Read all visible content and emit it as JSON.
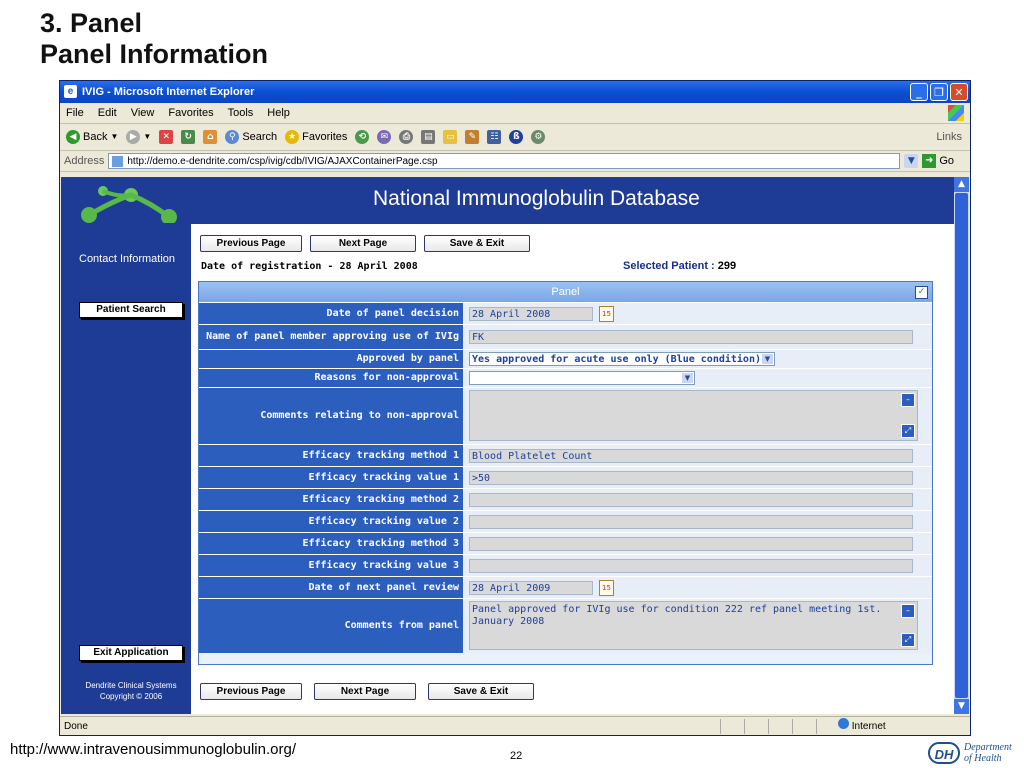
{
  "slide": {
    "heading_line1": "3. Panel",
    "heading_line2": "Panel Information",
    "footer_url": "http://www.intravenousimmunoglobulin.org/",
    "page_number": "22",
    "dh_badge": "DH",
    "dh_line1": "Department",
    "dh_line2": "of Health"
  },
  "browser": {
    "title": "IVIG - Microsoft Internet Explorer",
    "menu": [
      "File",
      "Edit",
      "View",
      "Favorites",
      "Tools",
      "Help"
    ],
    "toolbar": {
      "back": "Back",
      "search": "Search",
      "favorites": "Favorites",
      "links": "Links"
    },
    "address_label": "Address",
    "url": "http://demo.e-dendrite.com/csp/ivig/cdb/IVIG/AJAXContainerPage.csp",
    "go_label": "Go",
    "status_text": "Done",
    "zone_text": "Internet"
  },
  "app": {
    "title": "National Immunoglobulin Database",
    "contact_label": "Contact Information",
    "patient_search_label": "Patient Search",
    "exit_label": "Exit Application",
    "copyright_line1": "Dendrite Clinical Systems",
    "copyright_line2": "Copyright © 2006",
    "previous_label": "Previous Page",
    "next_label": "Next Page",
    "save_exit_label": "Save & Exit",
    "registration_text": "Date of registration - 28 April 2008",
    "selected_patient_label": "Selected Patient :",
    "selected_patient_value": "299"
  },
  "panel": {
    "heading": "Panel",
    "checkbox_checked": true,
    "fields": {
      "date_of_decision": {
        "label": "Date of panel decision",
        "value": "28 April 2008"
      },
      "member_name": {
        "label": "Name of panel member approving use of IVIg",
        "value": "FK"
      },
      "approved": {
        "label": "Approved by panel",
        "value": "Yes approved for acute use only (Blue condition)"
      },
      "reasons": {
        "label": "Reasons for non-approval",
        "value": ""
      },
      "comments_non_approval": {
        "label": "Comments relating to non-approval",
        "value": ""
      },
      "eff_method_1": {
        "label": "Efficacy tracking method 1",
        "value": "Blood Platelet Count"
      },
      "eff_value_1": {
        "label": "Efficacy tracking value 1",
        "value": ">50"
      },
      "eff_method_2": {
        "label": "Efficacy tracking method 2",
        "value": ""
      },
      "eff_value_2": {
        "label": "Efficacy tracking value 2",
        "value": ""
      },
      "eff_method_3": {
        "label": "Efficacy tracking method 3",
        "value": ""
      },
      "eff_value_3": {
        "label": "Efficacy tracking value 3",
        "value": ""
      },
      "next_review": {
        "label": "Date of next panel review",
        "value": "28 April 2009"
      },
      "comments_from_panel": {
        "label": "Comments from panel",
        "value": "Panel approved for IVIg use for condition 222 ref panel meeting 1st. January 2008"
      }
    }
  },
  "colors": {
    "app_background": "#1e3c96",
    "label_background": "#2c5ebd",
    "panel_header": "#7aa6e6"
  }
}
